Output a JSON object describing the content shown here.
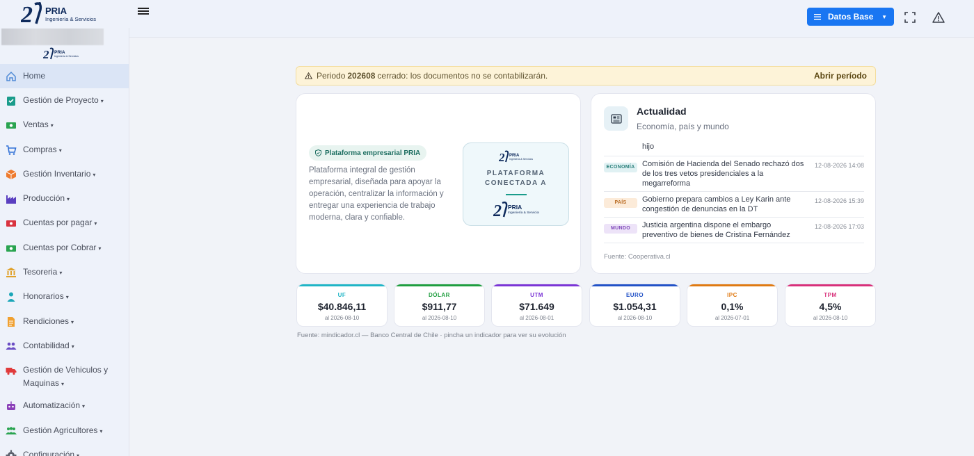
{
  "brand": {
    "name": "PRIA",
    "tagline": "Ingeniería & Servicios"
  },
  "topbar": {
    "datos_base_label": "Datos Base"
  },
  "sidebar": {
    "items": [
      {
        "label": "Home",
        "caret": "",
        "icon": "home-icon",
        "color": "#4f8ad6"
      },
      {
        "label": "Gestión de Proyecto",
        "caret": "▾",
        "icon": "clipboard-check-icon",
        "color": "#1a9c8b"
      },
      {
        "label": "Ventas",
        "caret": "▾",
        "icon": "money-icon",
        "color": "#2aa450"
      },
      {
        "label": "Compras",
        "caret": "▾",
        "icon": "cart-icon",
        "color": "#2f6fd6"
      },
      {
        "label": "Gestión Inventario",
        "caret": "▾",
        "icon": "box-icon",
        "color": "#ee7b2f"
      },
      {
        "label": "Producción",
        "caret": "▾",
        "icon": "factory-icon",
        "color": "#5a3fc0"
      },
      {
        "label": "Cuentas por pagar",
        "caret": "▾",
        "icon": "bill-icon",
        "color": "#d9333f"
      },
      {
        "label": "Cuentas por Cobrar",
        "caret": "▾",
        "icon": "money-icon",
        "color": "#2aa450"
      },
      {
        "label": "Tesoreria",
        "caret": "▾",
        "icon": "bank-icon",
        "color": "#e0a12a"
      },
      {
        "label": "Honorarios",
        "caret": "▾",
        "icon": "person-icon",
        "color": "#1ba6b8"
      },
      {
        "label": "Rendiciones",
        "caret": "▾",
        "icon": "document-icon",
        "color": "#f0a030"
      },
      {
        "label": "Contabilidad",
        "caret": "▾",
        "icon": "users-icon",
        "color": "#6a4cc4"
      },
      {
        "label": "Gestión de Vehiculos y Maquinas",
        "caret": "▾",
        "icon": "truck-icon",
        "color": "#e03a3a"
      },
      {
        "label": "Automatización",
        "caret": "▾",
        "icon": "robot-icon",
        "color": "#8a3fb8"
      },
      {
        "label": "Gestión Agricultores",
        "caret": "▾",
        "icon": "farmers-icon",
        "color": "#2aa450"
      },
      {
        "label": "Configuración",
        "caret": "▾",
        "icon": "gear-icon",
        "color": "#5a5f6b"
      }
    ]
  },
  "alert": {
    "prefix": "Periodo",
    "period": "202608",
    "suffix": "cerrado: los documentos no se contabilizarán.",
    "action": "Abrir período"
  },
  "platform_card": {
    "badge": "Plataforma empresarial PRIA",
    "description": "Plataforma integral de gestión empresarial, diseñada para apoyar la operación, centralizar la información y entregar una experiencia de trabajo moderna, clara y confiable.",
    "box_title": "PLATAFORMA CONECTADA A"
  },
  "news": {
    "title": "Actualidad",
    "subtitle": "Economía, país y mundo",
    "partial_text": "hijo",
    "items": [
      {
        "tag": "ECONOMÍA",
        "text": "Comisión de Hacienda del Senado rechazó dos de los tres vetos presidenciales a la megarreforma",
        "date": "12-08-2026 14:08"
      },
      {
        "tag": "PAÍS",
        "text": "Gobierno prepara cambios a Ley Karin ante congestión de denuncias en la DT",
        "date": "12-08-2026 15:39"
      },
      {
        "tag": "MUNDO",
        "text": "Justicia argentina dispone el embargo preventivo de bienes de Cristina Fernández",
        "date": "12-08-2026 17:03"
      }
    ],
    "source": "Fuente: Cooperativa.cl"
  },
  "indicators": {
    "items": [
      {
        "name": "UF",
        "value": "$40.846,11",
        "date": "al 2026-08-10",
        "color": "#1fb5c6"
      },
      {
        "name": "DÓLAR",
        "value": "$911,77",
        "date": "al 2026-08-10",
        "color": "#1f9e3f"
      },
      {
        "name": "UTM",
        "value": "$71.649",
        "date": "al 2026-08-01",
        "color": "#7b35d6"
      },
      {
        "name": "EURO",
        "value": "$1.054,31",
        "date": "al 2026-08-10",
        "color": "#2252c7"
      },
      {
        "name": "IPC",
        "value": "0,1%",
        "date": "al 2026-07-01",
        "color": "#e07a12"
      },
      {
        "name": "TPM",
        "value": "4,5%",
        "date": "al 2026-08-10",
        "color": "#d8307a"
      }
    ],
    "source": "Fuente: mindicador.cl — Banco Central de Chile · pincha un indicador para ver su evolución"
  }
}
